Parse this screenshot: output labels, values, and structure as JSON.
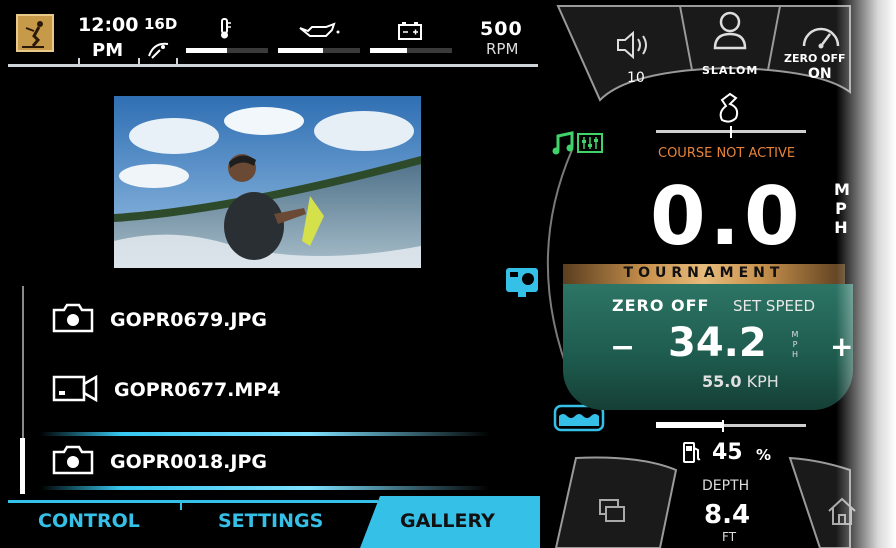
{
  "status_bar": {
    "time": "12:00",
    "ampm": "PM",
    "satellites": "16D",
    "rpm_value": "500",
    "rpm_unit": "RPM",
    "gauges": [
      {
        "name": "engine-temp",
        "icon": "thermometer-icon",
        "level": 0.5
      },
      {
        "name": "oil-pressure",
        "icon": "oil-can-icon",
        "level": 0.55
      },
      {
        "name": "battery",
        "icon": "battery-icon",
        "level": 0.45
      }
    ]
  },
  "media_list": {
    "items": [
      {
        "type": "photo",
        "icon": "camera-icon",
        "filename": "GOPR0679.JPG"
      },
      {
        "type": "video",
        "icon": "video-camera-icon",
        "filename": "GOPR0677.MP4"
      },
      {
        "type": "photo",
        "icon": "camera-icon",
        "filename": "GOPR0018.JPG",
        "selected": true
      }
    ]
  },
  "tabs": [
    {
      "label": "CONTROL",
      "active": false
    },
    {
      "label": "SETTINGS",
      "active": false
    },
    {
      "label": "GALLERY",
      "active": true
    }
  ],
  "dashboard": {
    "volume_value": "10",
    "slalom_label": "SLALOM",
    "zero_off_top": "ZERO OFF",
    "zero_off_state": "ON",
    "course_status": "COURSE NOT ACTIVE",
    "speed_value": "0.0",
    "speed_unit_letters": [
      "M",
      "P",
      "H"
    ],
    "tournament_label": "TOURNAMENT",
    "brand": "ZERO OFF",
    "set_speed_label": "SET SPEED",
    "set_speed_value": "34.2",
    "set_speed_unit_letters": [
      "M",
      "P",
      "H"
    ],
    "set_speed_minus": "−",
    "set_speed_plus": "+",
    "kph_value": "55.0",
    "kph_unit": "KPH",
    "fuel_value": "45",
    "fuel_unit": "%",
    "depth_label": "DEPTH",
    "depth_value": "8.4",
    "depth_unit": "FT"
  },
  "colors": {
    "accent_cyan": "#35c0e8",
    "accent_green": "#3fd36a",
    "course_orange": "#e8843a",
    "set_speed_teal": "#1d5a4d",
    "tournament_gold": "#c9924e",
    "zero_off_orange": "#f07a2a"
  }
}
